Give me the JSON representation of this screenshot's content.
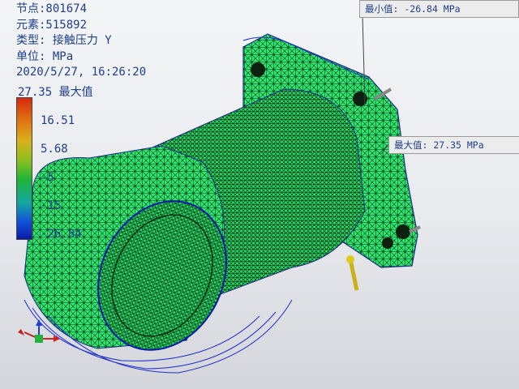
{
  "info": {
    "node": "节点:801674",
    "element": "元素:515892",
    "type": "类型: 接触压力 Y",
    "unit": "单位: MPa",
    "datetime": "2020/5/27, 16:26:20"
  },
  "legend": {
    "max_label": "27.35 最大值",
    "ticks": [
      "16.51",
      "5.68",
      "-5",
      "-15",
      "-26.84"
    ],
    "colors": [
      "#d42a10",
      "#d9b01a",
      "#1fb43a",
      "#14a8a0",
      "#0a1aa8"
    ]
  },
  "callouts": {
    "min": "最小值: -26.84 MPa",
    "max": "最大值: 27.35 MPa"
  },
  "triad_icon": "xyz-axis-triad-icon",
  "model_color": "#2ee870"
}
